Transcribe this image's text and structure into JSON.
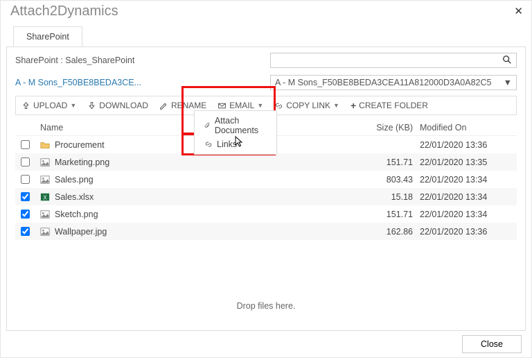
{
  "title": "Attach2Dynamics",
  "tab": "SharePoint",
  "sp_label": "SharePoint : Sales_SharePoint",
  "link": "A - M Sons_F50BE8BEDA3CE...",
  "selected": "A - M Sons_F50BE8BEDA3CEA11A812000D3A0A82C5",
  "toolbar": {
    "upload": "UPLOAD",
    "download": "DOWNLOAD",
    "rename": "RENAME",
    "email": "EMAIL",
    "copylink": "COPY LINK",
    "create": "CREATE FOLDER"
  },
  "dropdown": {
    "attach": "Attach Documents",
    "links": "Links"
  },
  "cols": {
    "name": "Name",
    "size": "Size (KB)",
    "mod": "Modified On"
  },
  "rows": [
    {
      "chk": false,
      "icon": "folder",
      "name": "Procurement",
      "size": "",
      "mod": "22/01/2020 13:36"
    },
    {
      "chk": false,
      "icon": "image",
      "name": "Marketing.png",
      "size": "151.71",
      "mod": "22/01/2020 13:35"
    },
    {
      "chk": false,
      "icon": "image",
      "name": "Sales.png",
      "size": "803.43",
      "mod": "22/01/2020 13:34"
    },
    {
      "chk": true,
      "icon": "excel",
      "name": "Sales.xlsx",
      "size": "15.18",
      "mod": "22/01/2020 13:34"
    },
    {
      "chk": true,
      "icon": "image",
      "name": "Sketch.png",
      "size": "151.71",
      "mod": "22/01/2020 13:34"
    },
    {
      "chk": true,
      "icon": "image",
      "name": "Wallpaper.jpg",
      "size": "162.86",
      "mod": "22/01/2020 13:36"
    }
  ],
  "drop": "Drop files here.",
  "close": "Close"
}
